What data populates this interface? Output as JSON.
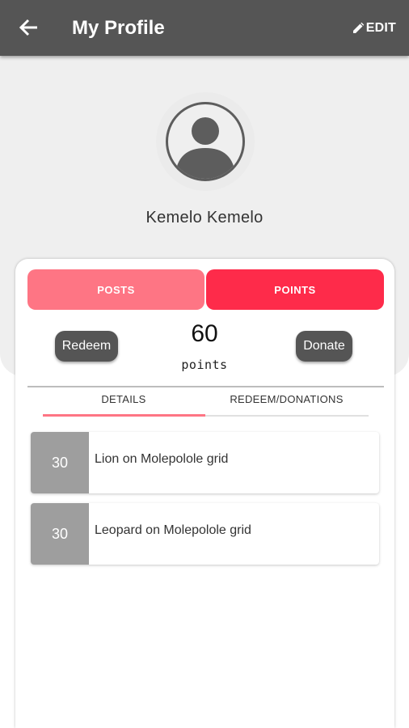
{
  "header": {
    "title": "My Profile",
    "edit_label": "EDIT",
    "background_color": "#555555"
  },
  "profile": {
    "name": "Kemelo Kemelo"
  },
  "segments": {
    "posts_label": "POSTS",
    "points_label": "POINTS",
    "selected": "POINTS",
    "posts_color": "#fe7584",
    "points_color": "#fe2b4a"
  },
  "points": {
    "value": "60",
    "unit": "points",
    "redeem_label": "Redeem",
    "donate_label": "Donate"
  },
  "tabs": [
    {
      "label": "DETAILS",
      "active": true
    },
    {
      "label": "REDEEM/DONATIONS",
      "active": false
    }
  ],
  "items": [
    {
      "points": "30",
      "description": "Lion on Molepolole grid"
    },
    {
      "points": "30",
      "description": "Leopard on Molepolole grid"
    }
  ],
  "icons": {
    "back": "arrow-left-icon",
    "edit": "pencil-icon",
    "avatar": "user-silhouette-icon"
  }
}
